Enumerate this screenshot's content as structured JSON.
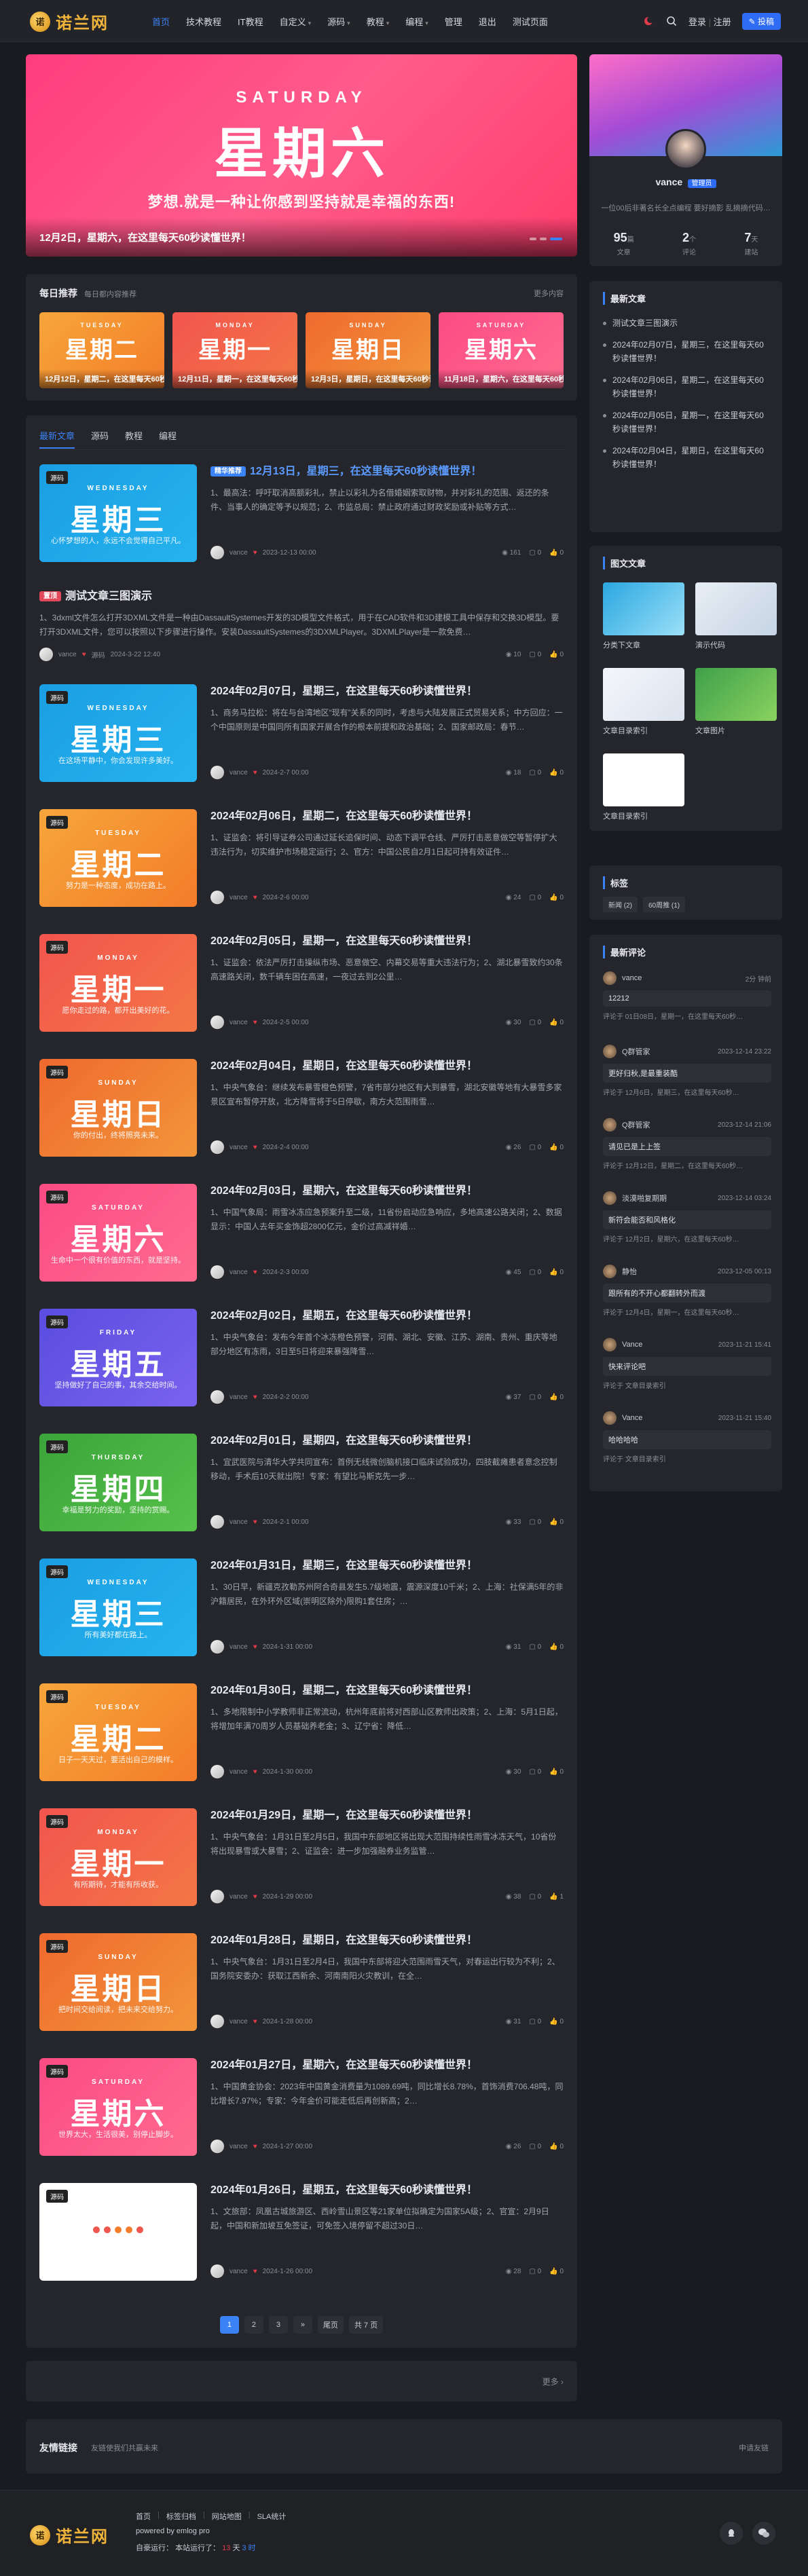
{
  "site": {
    "logo_text": "诺兰网",
    "logo_mark": "诺"
  },
  "nav": {
    "items": [
      {
        "label": "首页",
        "active": true
      },
      {
        "label": "技术教程"
      },
      {
        "label": "IT教程"
      },
      {
        "label": "自定义",
        "caret": "▾"
      },
      {
        "label": "源码",
        "caret": "▾"
      },
      {
        "label": "教程",
        "caret": "▾"
      },
      {
        "label": "编程",
        "caret": "▾"
      },
      {
        "label": "管理"
      },
      {
        "label": "退出"
      },
      {
        "label": "测试页面"
      }
    ],
    "login": "登录",
    "register": "注册",
    "publish": "投稿",
    "sep": "|"
  },
  "hero": {
    "en": "SATURDAY",
    "cn": "星期六",
    "sub": "梦想.就是一种让你感到坚持就是幸福的东西!",
    "caption": "12月2日，星期六，在这里每天60秒读懂世界！"
  },
  "daily": {
    "title": "每日推荐",
    "subtitle": "每日都内容推荐",
    "more": "更多内容",
    "cards": [
      {
        "en": "TUESDAY",
        "cn": "星期二",
        "caption": "12月12日，星期二，在这里每天60秒读懂世界！",
        "color1": "#f6a63a",
        "color2": "#f47c2a"
      },
      {
        "en": "MONDAY",
        "cn": "星期一",
        "caption": "12月11日，星期一，在这里每天60秒读懂世界！",
        "color1": "#f2554e",
        "color2": "#f47645"
      },
      {
        "en": "SUNDAY",
        "cn": "星期日",
        "caption": "12月3日，星期日，在这里每天60秒读懂世界！",
        "color1": "#ef6a2e",
        "color2": "#f2953a"
      },
      {
        "en": "SATURDAY",
        "cn": "星期六",
        "caption": "11月18日，星期六，在这里每天60秒读懂世界！",
        "color1": "#fb4b84",
        "color2": "#ff6b8e"
      }
    ]
  },
  "tabs": [
    {
      "label": "最新文章",
      "active": true
    },
    {
      "label": "源码"
    },
    {
      "label": "教程"
    },
    {
      "label": "编程"
    }
  ],
  "posts": [
    {
      "type": "thumb",
      "cat": "源码",
      "en": "WEDNESDAY",
      "cn": "星期三",
      "sub": "心怀梦想的人，永远不会觉得自己平凡。",
      "c1": "#1a9ee3",
      "c2": "#26b3ef",
      "pill": "精华推荐",
      "title": "12月13日，星期三，在这里每天60秒读懂世界！",
      "excerpt": "1、最高法：呼吁取消高额彩礼，禁止以彩礼为名借婚姻索取财物，并对彩礼的范围、返还的条件、当事人的确定等予以规范；2、市监总局：禁止政府通过财政奖励或补贴等方式…",
      "author": "vance",
      "date": "2023-12-13 00:00",
      "views": "161",
      "comments": "0",
      "likes": "0",
      "title_color": "#5b9bff"
    },
    {
      "type": "text",
      "tag": "置顶",
      "title": "测试文章三图演示",
      "excerpt": "1、3dxml文件怎么打开3DXML文件是一种由DassaultSystemes开发的3D模型文件格式，用于在CAD软件和3D建模工具中保存和交换3D模型。要打开3DXML文件，您可以按照以下步骤进行操作。安装DassaultSystemes的3DXMLPlayer。3DXMLPlayer是一款免费…",
      "author": "vance",
      "cat": "源码",
      "date": "2024-3-22 12:40",
      "views": "10",
      "comments": "0",
      "likes": "0"
    },
    {
      "type": "thumb",
      "cat": "源码",
      "en": "WEDNESDAY",
      "cn": "星期三",
      "sub": "在这场平静中，你会发现许多美好。",
      "c1": "#1a9ee3",
      "c2": "#26b3ef",
      "title": "2024年02月07日，星期三，在这里每天60秒读懂世界！",
      "excerpt": "1、商务马拉松：将在与台湾地区“现有”关系的同时，考虑与大陆发展正式贸易关系；中方回应：一个中国原则是中国同所有国家开展合作的根本前提和政治基础；2、国家邮政局：春节…",
      "author": "vance",
      "date": "2024-2-7 00:00",
      "views": "18",
      "comments": "0",
      "likes": "0"
    },
    {
      "type": "thumb",
      "cat": "源码",
      "en": "TUESDAY",
      "cn": "星期二",
      "sub": "努力是一种态度，成功在路上。",
      "c1": "#f6a63a",
      "c2": "#f47c2a",
      "title": "2024年02月06日，星期二，在这里每天60秒读懂世界！",
      "excerpt": "1、证监会：将引导证券公司通过延长追保时间、动态下调平仓线、严厉打击恶意做空等暂停扩大违法行为，切实维护市场稳定运行；2、官方：中国公民自2月1日起可持有效证件…",
      "author": "vance",
      "date": "2024-2-6 00:00",
      "views": "24",
      "comments": "0",
      "likes": "0"
    },
    {
      "type": "thumb",
      "cat": "源码",
      "en": "MONDAY",
      "cn": "星期一",
      "sub": "愿你走过的路，都开出美好的花。",
      "c1": "#f2554e",
      "c2": "#f47645",
      "title": "2024年02月05日，星期一，在这里每天60秒读懂世界！",
      "excerpt": "1、证监会：依法严厉打击操纵市场、恶意做空、内幕交易等重大违法行为；2、湖北暴雪致约30条高速路关闭，数千辆车困在高速，一夜过去到2公里…",
      "author": "vance",
      "date": "2024-2-5 00:00",
      "views": "30",
      "comments": "0",
      "likes": "0"
    },
    {
      "type": "thumb",
      "cat": "源码",
      "en": "SUNDAY",
      "cn": "星期日",
      "sub": "你的付出，终将照亮未来。",
      "c1": "#ef6a2e",
      "c2": "#f2953a",
      "title": "2024年02月04日，星期日，在这里每天60秒读懂世界！",
      "excerpt": "1、中央气象台：继续发布暴雪橙色预警，7省市部分地区有大到暴雪，湖北安徽等地有大暴雪多家景区宣布暂停开放，北方降雪将于5日停歇，南方大范围雨雪…",
      "author": "vance",
      "date": "2024-2-4 00:00",
      "views": "26",
      "comments": "0",
      "likes": "0"
    },
    {
      "type": "thumb",
      "cat": "源码",
      "en": "SATURDAY",
      "cn": "星期六",
      "sub": "生命中一个很有价值的东西，就是坚持。",
      "c1": "#fb4b84",
      "c2": "#ff6b8e",
      "title": "2024年02月03日，星期六，在这里每天60秒读懂世界！",
      "excerpt": "1、中国气象局：雨雪冰冻应急预案升至二级，11省份启动应急响应，多地高速公路关闭；2、数据显示：中国人去年买金饰超2800亿元，金价过高减祥婚…",
      "author": "vance",
      "date": "2024-2-3 00:00",
      "views": "45",
      "comments": "0",
      "likes": "0"
    },
    {
      "type": "thumb",
      "cat": "源码",
      "en": "FRIDAY",
      "cn": "星期五",
      "sub": "坚持做好了自己的事，其余交给时间。",
      "c1": "#5a4de0",
      "c2": "#7a63ee",
      "title": "2024年02月02日，星期五，在这里每天60秒读懂世界！",
      "excerpt": "1、中央气象台：发布今年首个冰冻橙色预警，河南、湖北、安徽、江苏、湖南、贵州、重庆等地部分地区有冻雨，3日至5日将迎来暴强降雪…",
      "author": "vance",
      "date": "2024-2-2 00:00",
      "views": "37",
      "comments": "0",
      "likes": "0"
    },
    {
      "type": "thumb",
      "cat": "源码",
      "en": "THURSDAY",
      "cn": "星期四",
      "sub": "幸福是努力的奖励，坚持的赏赐。",
      "c1": "#3ba53b",
      "c2": "#57c14b",
      "title": "2024年02月01日，星期四，在这里每天60秒读懂世界！",
      "excerpt": "1、宜武医院与清华大学共同宣布：首例无线微创脑机接口临床试验成功，四肢截瘫患者意念控制移动，手术后10天就出院！专家：有望比马斯克先一步…",
      "author": "vance",
      "date": "2024-2-1 00:00",
      "views": "33",
      "comments": "0",
      "likes": "0"
    },
    {
      "type": "thumb",
      "cat": "源码",
      "en": "WEDNESDAY",
      "cn": "星期三",
      "sub": "所有美好都在路上。",
      "c1": "#1a9ee3",
      "c2": "#26b3ef",
      "title": "2024年01月31日，星期三，在这里每天60秒读懂世界！",
      "excerpt": "1、30日早，新疆克孜勒苏州阿合奇县发生5.7级地震，震源深度10千米；2、上海：社保满5年的非沪籍居民，在外环外区域(崇明区除外)限购1套住房；…",
      "author": "vance",
      "date": "2024-1-31 00:00",
      "views": "31",
      "comments": "0",
      "likes": "0"
    },
    {
      "type": "thumb",
      "cat": "源码",
      "en": "TUESDAY",
      "cn": "星期二",
      "sub": "日子一天天过，要活出自己的模样。",
      "c1": "#f6a63a",
      "c2": "#f47c2a",
      "title": "2024年01月30日，星期二，在这里每天60秒读懂世界！",
      "excerpt": "1、多地限制中小学教师非正常流动，杭州年底前将对西部山区教师出政策；2、上海：5月1日起，将增加年满70周岁人员基础养老金；3、辽宁省：降低…",
      "author": "vance",
      "date": "2024-1-30 00:00",
      "views": "30",
      "comments": "0",
      "likes": "0"
    },
    {
      "type": "thumb",
      "cat": "源码",
      "en": "MONDAY",
      "cn": "星期一",
      "sub": "有所期待，才能有所收获。",
      "c1": "#f2554e",
      "c2": "#f47645",
      "title": "2024年01月29日，星期一，在这里每天60秒读懂世界！",
      "excerpt": "1、中央气象台：1月31日至2月5日，我国中东部地区将出现大范围持续性雨雪冰冻天气，10省份将出现暴雪或大暴雪；2、证监会：进一步加强融券业务监管…",
      "author": "vance",
      "date": "2024-1-29 00:00",
      "views": "38",
      "comments": "0",
      "likes": "1"
    },
    {
      "type": "thumb",
      "cat": "源码",
      "en": "SUNDAY",
      "cn": "星期日",
      "sub": "把时间交给阅读，把未来交给努力。",
      "c1": "#ef6a2e",
      "c2": "#f2953a",
      "title": "2024年01月28日，星期日，在这里每天60秒读懂世界！",
      "excerpt": "1、中央气象台：1月31日至2月4日，我国中东部将迎大范围雨雪天气，对春运出行较为不利；2、国务院安委办：获取江西新余、河南南阳火灾教训，在全…",
      "author": "vance",
      "date": "2024-1-28 00:00",
      "views": "31",
      "comments": "0",
      "likes": "0"
    },
    {
      "type": "thumb",
      "cat": "源码",
      "en": "SATURDAY",
      "cn": "星期六",
      "sub": "世界太大，生活很美，别停止脚步。",
      "c1": "#fb4b84",
      "c2": "#ff6b8e",
      "title": "2024年01月27日，星期六，在这里每天60秒读懂世界！",
      "excerpt": "1、中国黄金协会：2023年中国黄金消费量为1089.69吨，同比增长8.78%，首饰消费706.48吨，同比增长7.97%；专家：今年金价可能走低后再创新高；2…",
      "author": "vance",
      "date": "2024-1-27 00:00",
      "views": "26",
      "comments": "0",
      "likes": "0"
    },
    {
      "type": "thumb",
      "cat": "源码",
      "en": "",
      "cn": "",
      "sub": "",
      "c1": "#ffffff",
      "c2": "#ffffff",
      "loading": true,
      "title": "2024年01月26日，星期五，在这里每天60秒读懂世界！",
      "excerpt": "1、文旅部：凤凰古城旅游区、西岭雪山景区等21家单位拟确定为国家5A级；2、官宣：2月9日起，中国和新加坡互免签证，可免签入境停留不超过30日…",
      "author": "vance",
      "date": "2024-1-26 00:00",
      "views": "28",
      "comments": "0",
      "likes": "0"
    }
  ],
  "pager": {
    "pages": [
      "1",
      "2",
      "3",
      "»",
      "尾页",
      "共 7 页"
    ]
  },
  "more_bar": {
    "label": "更多 ›"
  },
  "links": {
    "title": "友情链接",
    "subtitle": "友链使我们共赢未来",
    "apply": "申请友链"
  },
  "profile": {
    "name": "vance",
    "badge": "管理员",
    "bio": "一位00后非著名长全点编程 要好摘影 乱摘摘代码…",
    "stats": [
      {
        "value": "95",
        "unit": "篇",
        "label": "文章"
      },
      {
        "value": "2",
        "unit": "个",
        "label": "评论"
      },
      {
        "value": "7",
        "unit": "天",
        "label": "建站"
      }
    ]
  },
  "latest": {
    "title": "最新文章",
    "items": [
      "测试文章三图演示",
      "2024年02月07日，星期三，在这里每天60秒读懂世界！",
      "2024年02月06日，星期二，在这里每天60秒读懂世界！",
      "2024年02月05日，星期一，在这里每天60秒读懂世界！",
      "2024年02月04日，星期日，在这里每天60秒读懂世界！"
    ]
  },
  "imgs": {
    "title": "图文文章",
    "items": [
      "分类下文章",
      "演示代码",
      "文章目录索引",
      "文章图片",
      "文章目录索引"
    ]
  },
  "tags": {
    "title": "标签",
    "items": [
      "新闻 (2)",
      "60周推 (1)"
    ]
  },
  "comments": {
    "title": "最新评论",
    "items": [
      {
        "name": "vance",
        "date": "2分 钟前",
        "text": "12212",
        "ref": "评论于 01日08日，星期一，在这里每天60秒…"
      },
      {
        "name": "Q群管家",
        "date": "2023-12-14 23:22",
        "text": "更好归秋,是最重装酷",
        "ref": "评论于 12月6日，星期三，在这里每天60秒…"
      },
      {
        "name": "Q群管家",
        "date": "2023-12-14 21:06",
        "text": "请见已是上上签",
        "ref": "评论于 12月12日，星期二，在这里每天60秒…"
      },
      {
        "name": "淡漠啪复期期",
        "date": "2023-12-14 03:24",
        "text": "新符会能否和风格化",
        "ref": "评论于 12月2日，星期六，在这里每天60秒…"
      },
      {
        "name": "静怡",
        "date": "2023-12-05 00:13",
        "text": "跟所有的不开心都翻转外而渡",
        "ref": "评论于 12月4日，星期一，在这里每天60秒…"
      },
      {
        "name": "Vance",
        "date": "2023-11-21 15:41",
        "text": "快来评论吧",
        "ref": "评论于 文章目录索引"
      },
      {
        "name": "Vance",
        "date": "2023-11-21 15:40",
        "text": "哈哈哈哈",
        "ref": "评论于 文章目录索引"
      }
    ]
  },
  "footer": {
    "links": [
      "首页",
      "标签归档",
      "网站地图",
      "SLA统计"
    ],
    "powered": "powered by emlog pro",
    "runtime_label": "自豪运行：",
    "runtime_value": "本站运行了：",
    "days": "13",
    "hours": "天",
    "run_tail": "3 时"
  }
}
